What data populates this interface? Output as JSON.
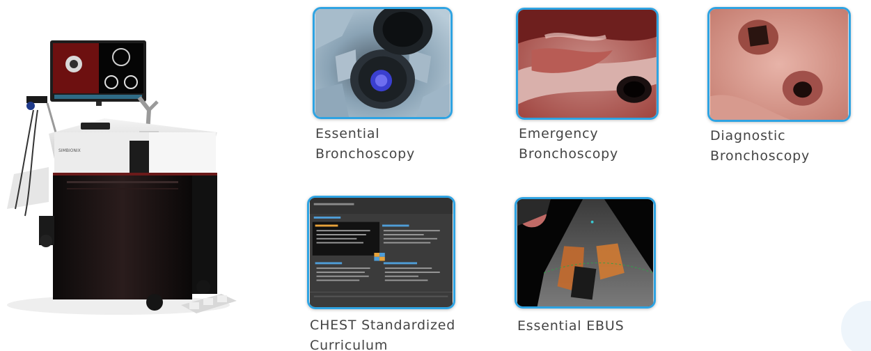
{
  "modules": [
    {
      "title": "Essential\nBronchoscopy",
      "image": "airway-virtual-view"
    },
    {
      "title": "Emergency\nBronchoscopy",
      "image": "bleeding-airway-view"
    },
    {
      "title": "Diagnostic\nBronchoscopy",
      "image": "bronchial-branch-view"
    },
    {
      "title": "CHEST Standardized\nCurriculum",
      "image": "curriculum-slide"
    },
    {
      "title": "Essential EBUS",
      "image": "ultrasound-view"
    }
  ],
  "simulator": {
    "brand": "SIMBIONIX",
    "image": "bronchoscopy-simulator-cart"
  },
  "colors": {
    "tile_border": "#2ea3e2",
    "caption_text": "#444444"
  }
}
